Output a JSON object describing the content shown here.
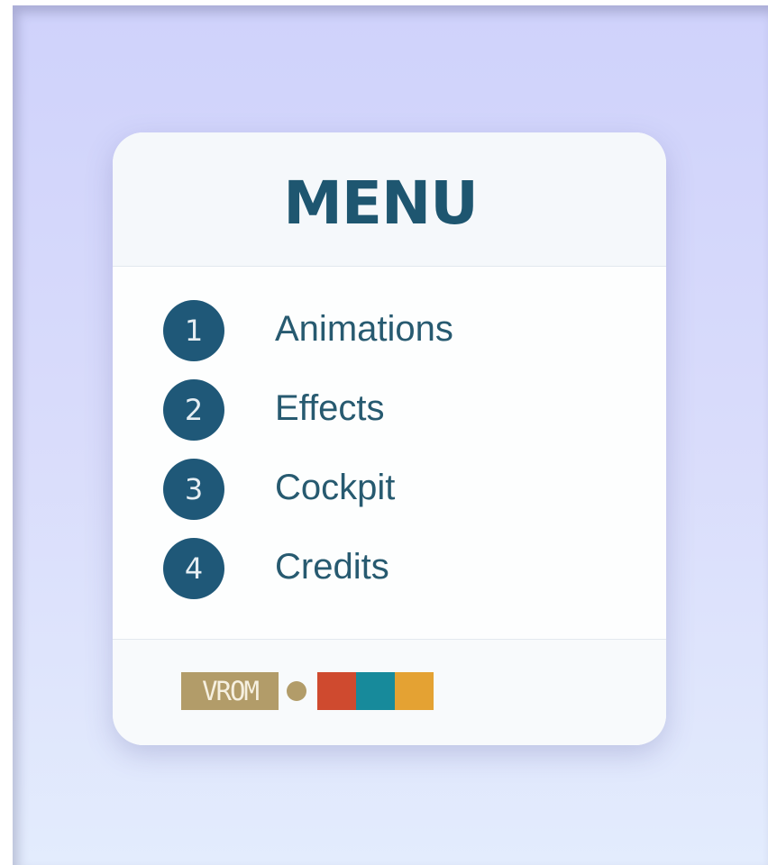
{
  "menu": {
    "title": "MENU",
    "items": [
      {
        "number": "1",
        "label": "Animations"
      },
      {
        "number": "2",
        "label": "Effects"
      },
      {
        "number": "3",
        "label": "Cockpit"
      },
      {
        "number": "4",
        "label": "Credits"
      }
    ]
  },
  "footer": {
    "logo_text": "VROM",
    "logo_colors": [
      "#cf4a2f",
      "#178a9b",
      "#e4a233"
    ]
  },
  "colors": {
    "accent": "#1f5878",
    "title": "#1e5670",
    "logo_tan": "#b29c69"
  }
}
